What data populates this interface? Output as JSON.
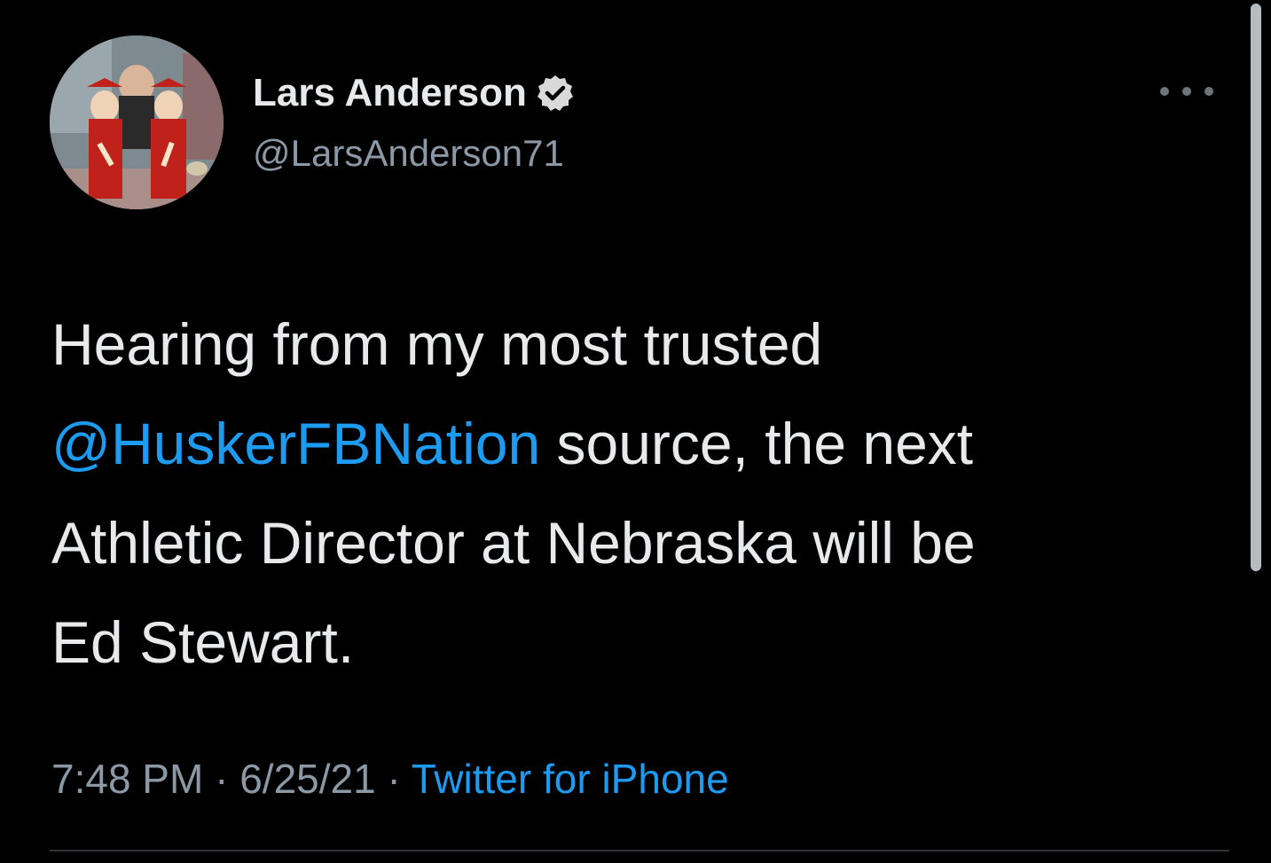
{
  "author": {
    "display_name": "Lars Anderson",
    "handle": "@LarsAnderson71",
    "verified": true
  },
  "tweet": {
    "text_line1": "Hearing from my most trusted",
    "mention": "@HuskerFBNation",
    "text_line2_rest": " source, the next",
    "text_line3": "Athletic Director at Nebraska will be",
    "text_line4": "Ed Stewart."
  },
  "meta": {
    "time": "7:48 PM",
    "separator1": " · ",
    "date": "6/25/21",
    "separator2": " · ",
    "source": "Twitter for iPhone"
  },
  "icons": {
    "verified": "verified-badge-icon",
    "more": "more-options-icon"
  },
  "colors": {
    "background": "#000000",
    "text": "#e7e9ea",
    "secondary": "#8b98a5",
    "accent": "#1d9bf0"
  }
}
